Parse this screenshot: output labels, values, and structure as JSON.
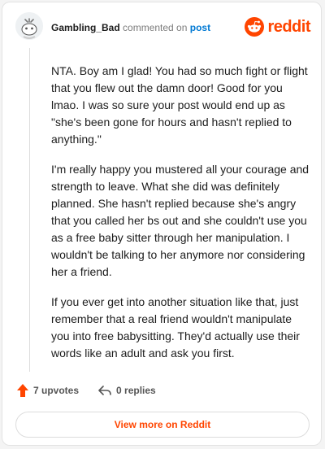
{
  "comment": {
    "username": "Gambling_Bad",
    "action_text": "commented on",
    "post_link": "post",
    "paragraphs": [
      "NTA. Boy am I glad! You had so much fight or flight that you flew out the damn door! Good for you lmao. I was so sure your post would end up as \"she's been gone for hours and hasn't replied to anything.\"",
      "I'm really happy you mustered all your courage and strength to leave. What she did was definitely planned. She hasn't replied because she's angry that you called her bs out and she couldn't use you as a free baby sitter through her manipulation. I wouldn't be talking to her anymore nor considering her a friend.",
      "If you ever get into another situation like that, just remember that a real friend wouldn't manipulate you into free babysitting. They'd actually use their words like an adult and ask you first."
    ],
    "upvotes_label": "7 upvotes",
    "replies_label": "0 replies"
  },
  "brand": {
    "name": "reddit",
    "color": "#ff4500"
  },
  "footer": {
    "view_more_label": "View more on Reddit"
  }
}
